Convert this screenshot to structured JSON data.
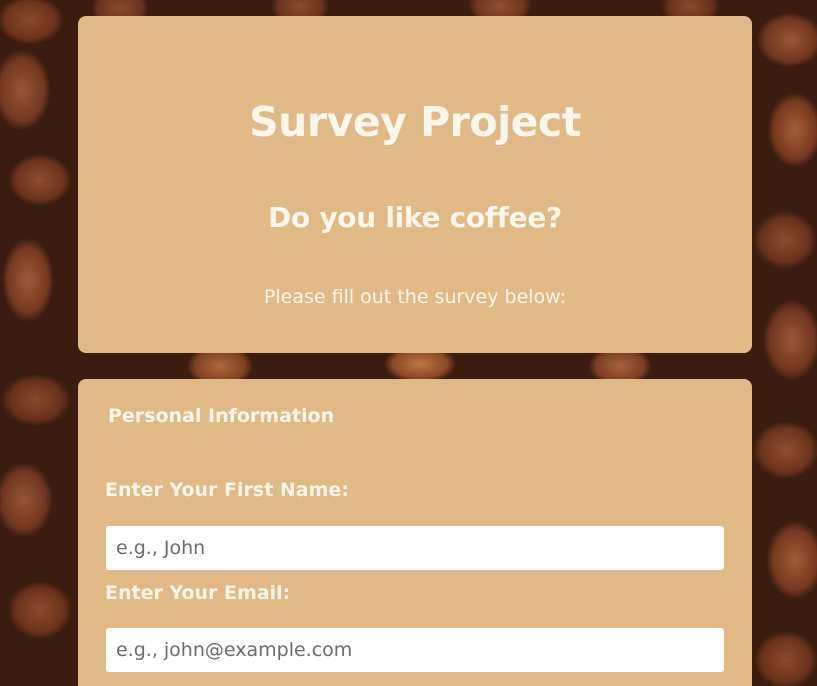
{
  "header": {
    "title": "Survey Project",
    "subtitle": "Do you like coffee?",
    "description": "Please fill out the survey below:"
  },
  "form": {
    "section_title": "Personal Information",
    "first_name": {
      "label": "Enter Your First Name:",
      "placeholder": "e.g., John",
      "value": ""
    },
    "email": {
      "label": "Enter Your Email:",
      "placeholder": "e.g., john@example.com",
      "value": ""
    }
  },
  "colors": {
    "card_background": "#dfba88",
    "text": "#fbf5ea",
    "input_background": "#ffffff"
  }
}
